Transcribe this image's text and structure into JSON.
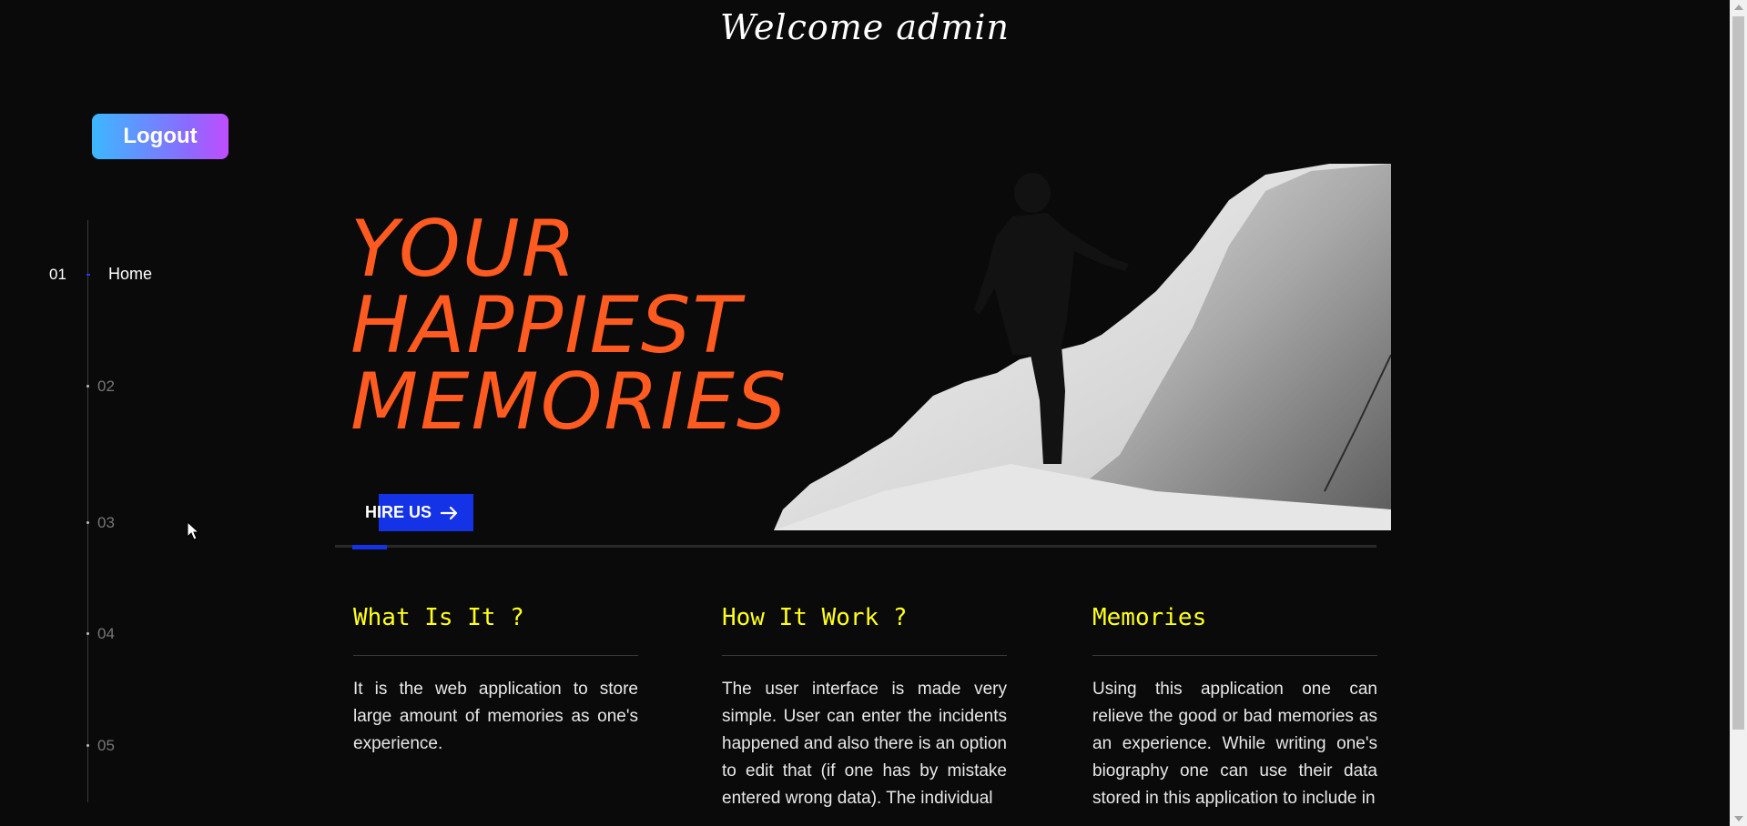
{
  "header": {
    "welcome": "Welcome admin"
  },
  "logout": {
    "label": "Logout"
  },
  "sidenav": {
    "items": [
      {
        "num": "01",
        "label": "Home"
      },
      {
        "num": "02"
      },
      {
        "num": "03"
      },
      {
        "num": "04"
      },
      {
        "num": "05"
      }
    ]
  },
  "hero": {
    "lines": [
      "YOUR",
      "HAPPIEST",
      "MEMORIES"
    ],
    "cta_label": "HIRE US",
    "slide_progress": 0.03
  },
  "sections": [
    {
      "title": "What Is It ?",
      "text": "It is the web application to store large amount of memories as one's experience."
    },
    {
      "title": "How It Work ?",
      "text": "The user interface is made very simple. User can enter the incidents happened and also there is an option to edit that (if one has by mistake entered wrong data). The individual"
    },
    {
      "title": "Memories",
      "text": "Using this application one can relieve the good or bad memories as an experience. While writing one's biography one can use their data stored in this application to include in"
    }
  ],
  "colors": {
    "background": "#0a0a0a",
    "hero_text": "#ff5a1f",
    "section_title": "#ffff1a",
    "accent_blue": "#1433e6"
  },
  "icons": {
    "cta": "arrow-right-icon"
  }
}
